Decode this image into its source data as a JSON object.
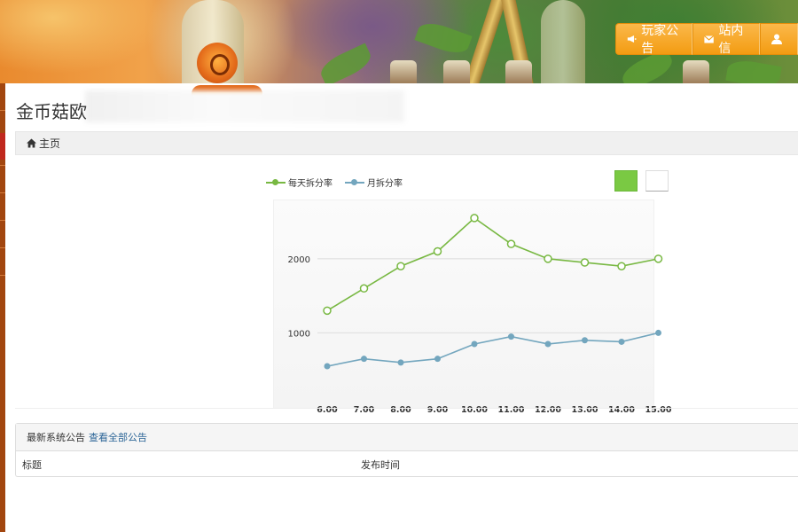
{
  "header": {
    "nav": [
      {
        "icon": "megaphone-icon",
        "label": "玩家公告"
      },
      {
        "icon": "mail-icon",
        "label": "站内信"
      },
      {
        "icon": "user-icon",
        "label": ""
      }
    ]
  },
  "page": {
    "title": "金币菇欧",
    "breadcrumb": {
      "icon": "home-icon",
      "label": "主页"
    }
  },
  "chart_data": {
    "type": "line",
    "x": [
      "6.00",
      "7.00",
      "8.00",
      "9.00",
      "10.00",
      "11.00",
      "12.00",
      "13.00",
      "14.00",
      "15.00"
    ],
    "series": [
      {
        "name": "每天拆分率",
        "color": "#78b842",
        "values": [
          1300,
          1600,
          1900,
          2100,
          2550,
          2200,
          2000,
          1950,
          1900,
          2000
        ]
      },
      {
        "name": "月拆分率",
        "color": "#73a6be",
        "values": [
          550,
          650,
          600,
          650,
          850,
          950,
          850,
          900,
          880,
          1000
        ]
      }
    ],
    "yticks": [
      1000,
      2000
    ],
    "ylim": [
      0,
      2800
    ],
    "grid": true,
    "legend": "top-left"
  },
  "announcements": {
    "heading": "最新系统公告",
    "view_all": "查看全部公告",
    "columns": [
      "标题",
      "发布时间"
    ]
  }
}
